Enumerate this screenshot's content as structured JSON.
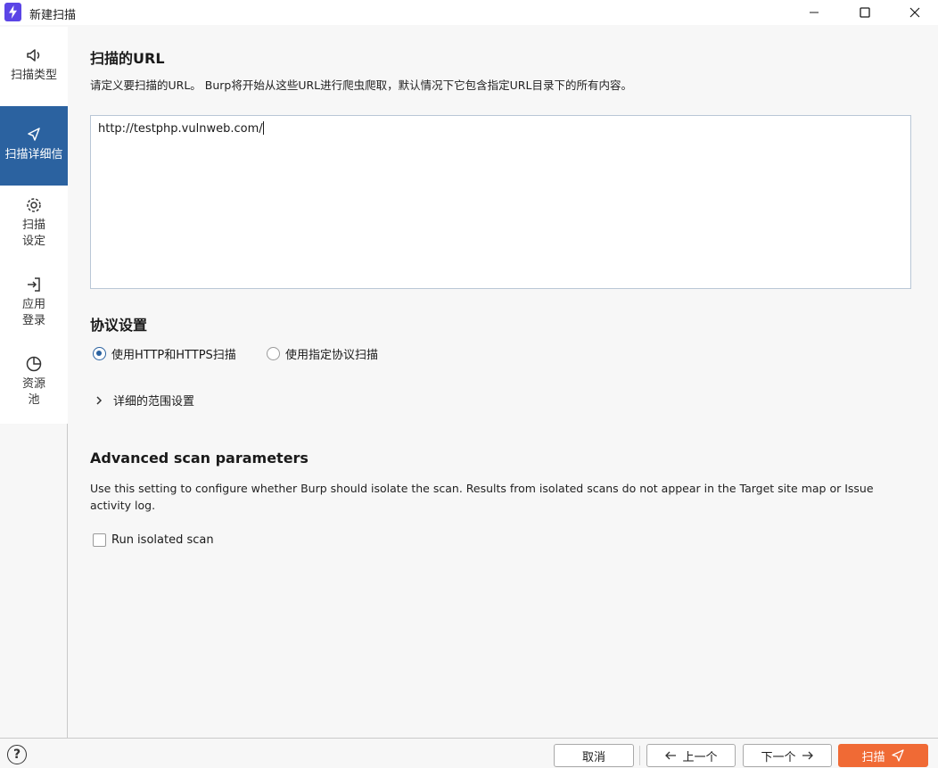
{
  "window": {
    "title": "新建扫描",
    "app_icon": "burp-bolt-icon"
  },
  "sidebar": {
    "items": [
      {
        "label": "扫描类型",
        "icon": "speaker-icon",
        "active": false
      },
      {
        "label": "扫描详细信",
        "icon": "send-icon",
        "active": true
      },
      {
        "label": "扫描\n设定",
        "icon": "gear-icon",
        "active": false
      },
      {
        "label": "应用\n登录",
        "icon": "login-icon",
        "active": false
      },
      {
        "label": "资源\n池",
        "icon": "pie-icon",
        "active": false
      }
    ]
  },
  "url_section": {
    "title": "扫描的URL",
    "description": "请定义要扫描的URL。 Burp将开始从这些URL进行爬虫爬取，默认情况下它包含指定URL目录下的所有内容。",
    "value": "http://testphp.vulnweb.com/"
  },
  "protocol_section": {
    "title": "协议设置",
    "options": [
      {
        "label": "使用HTTP和HTTPS扫描",
        "checked": true
      },
      {
        "label": "使用指定协议扫描",
        "checked": false
      }
    ],
    "details_label": "详细的范围设置"
  },
  "advanced_section": {
    "title": "Advanced scan parameters",
    "description": "Use this setting to configure whether Burp should isolate the scan. Results from isolated scans do not appear in the Target site map or Issue activity log.",
    "isolated_label": "Run isolated scan",
    "isolated_checked": false
  },
  "footer": {
    "cancel": "取消",
    "prev": "上一个",
    "next": "下一个",
    "scan": "扫描"
  },
  "colors": {
    "accent": "#2b62a0",
    "primary_button": "#f06a35",
    "app_icon": "#5b45e6"
  }
}
